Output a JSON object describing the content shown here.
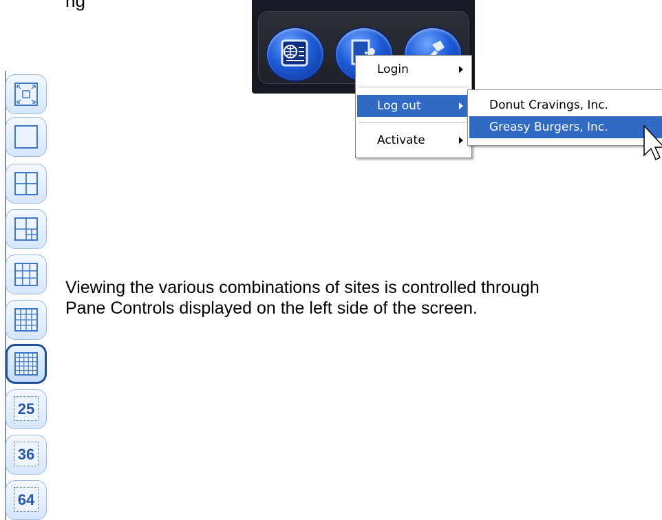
{
  "caption_partial": "ng",
  "menus": {
    "main": [
      {
        "label": "Login",
        "has_submenu": true,
        "highlighted": false
      },
      {
        "label": "Log out",
        "has_submenu": true,
        "highlighted": true
      },
      {
        "label": "Activate",
        "has_submenu": true,
        "highlighted": false
      }
    ],
    "logout_submenu": [
      {
        "label": "Donut Cravings, Inc.",
        "highlighted": false
      },
      {
        "label": "Greasy Burgers, Inc.",
        "highlighted": true
      }
    ]
  },
  "toolbar": {
    "buttons": [
      "sites-icon",
      "user-door-icon",
      "tools-icon"
    ]
  },
  "pane_controls": [
    {
      "name": "fullscreen",
      "icon": "fullscreen-icon",
      "label": "",
      "active": false
    },
    {
      "name": "1x1",
      "icon": "single-pane-icon",
      "label": "",
      "active": false
    },
    {
      "name": "2x2",
      "icon": "grid-2x2-icon",
      "label": "",
      "active": false
    },
    {
      "name": "1+grid",
      "icon": "grid-mixed-icon",
      "label": "",
      "active": false
    },
    {
      "name": "3x3",
      "icon": "grid-3x3-icon",
      "label": "",
      "active": false
    },
    {
      "name": "4x4",
      "icon": "grid-4x4-icon",
      "label": "",
      "active": false
    },
    {
      "name": "5x5",
      "icon": "grid-5x5-icon",
      "label": "",
      "active": true
    },
    {
      "name": "25",
      "icon": "number-icon",
      "label": "25",
      "active": false
    },
    {
      "name": "36",
      "icon": "number-icon",
      "label": "36",
      "active": false
    },
    {
      "name": "64",
      "icon": "number-icon",
      "label": "64",
      "active": false
    }
  ],
  "body_text": "Viewing the various combinations of sites is controlled through\nPane Controls displayed on the left side of the screen.",
  "colors": {
    "menu_highlight": "#316ac5",
    "toolbar_bg": "#151923",
    "pane_border": "#3d78c6",
    "pane_active_border": "#1f4f98"
  }
}
